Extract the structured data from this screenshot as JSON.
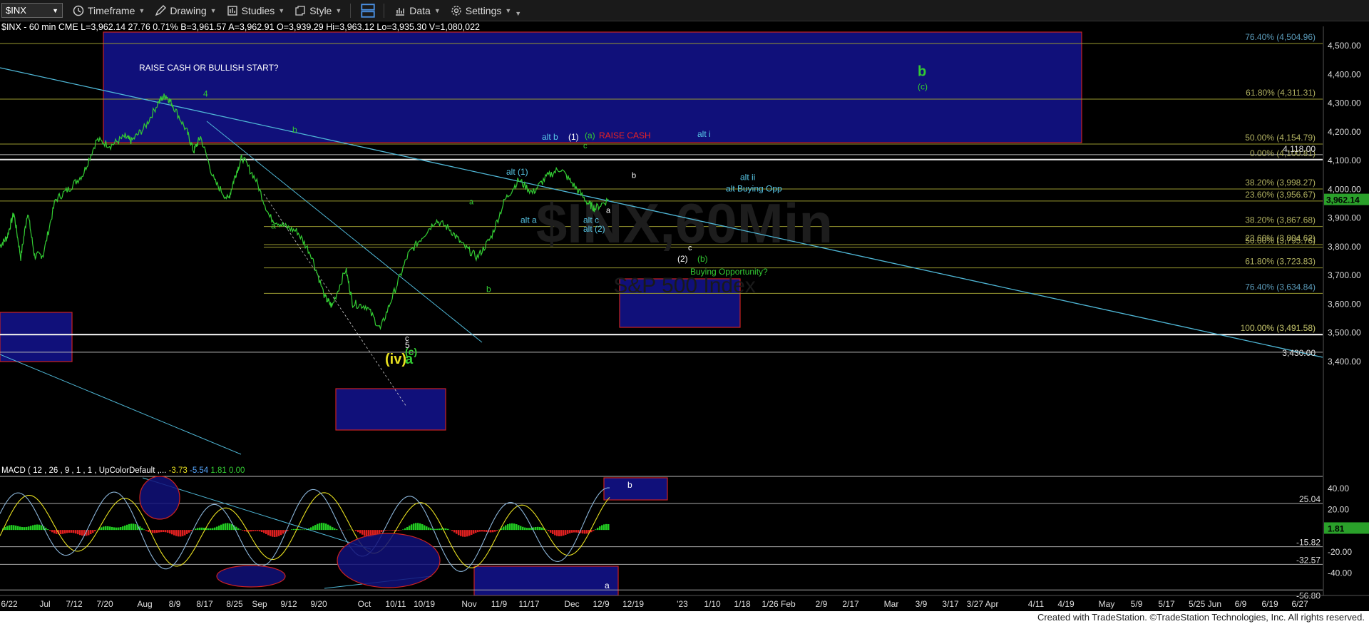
{
  "toolbar": {
    "symbol": "$INX",
    "timeframe": "Timeframe",
    "drawing": "Drawing",
    "studies": "Studies",
    "style": "Style",
    "data": "Data",
    "settings": "Settings"
  },
  "quote_line": "$INX - 60 min CME  L=3,962.14  27.76  0.71%  B=3,961.57  A=3,962.91  O=3,939.29  Hi=3,963.12  Lo=3,935.30  V=1,080,022",
  "watermark": "$INX,60Min",
  "watermark2": "S&P 500 Index",
  "macd_header": {
    "label": "MACD ( 12 , 26 , 9 , 1 , 1 , UpColorDefault ,...",
    "v1": "-3.73",
    "v2": "-5.54",
    "v3": "1.81",
    "v4": "0.00"
  },
  "footer": "Created with TradeStation. ©TradeStation Technologies, Inc. All rights reserved.",
  "colors": {
    "price": "#33cc33",
    "fib": "#9a9a30",
    "trend": "#4fb7d6",
    "box": "#10107a",
    "box_border": "#cc2222",
    "green_label": "#33cc33",
    "white_label": "#ffffff",
    "cyan_label": "#58c8e8",
    "yellow_label": "#e8e020",
    "red_label": "#ee2222"
  },
  "chart_data": {
    "type": "line",
    "title": "$INX - 60 min",
    "price_axis": {
      "ticks": [
        "4,500.00",
        "4,400.00",
        "4,300.00",
        "4,200.00",
        "4,100.00",
        "4,000.00",
        "3,900.00",
        "3,800.00",
        "3,700.00",
        "3,600.00",
        "3,500.00",
        "3,400.00"
      ],
      "ylim": [
        3350,
        4590
      ],
      "last_price": "3,962.14"
    },
    "x_axis": {
      "ticks": [
        "6/22",
        "Jul",
        "7/12",
        "7/20",
        "Aug",
        "8/9",
        "8/17",
        "8/25",
        "Sep",
        "9/12",
        "9/20",
        "Oct",
        "10/11",
        "10/19",
        "Nov",
        "11/9",
        "11/17",
        "Dec",
        "12/9",
        "12/19",
        "'23",
        "1/10",
        "1/18",
        "1/26 Feb",
        "2/9",
        "2/17",
        "Mar",
        "3/9",
        "3/17",
        "3/27 Apr",
        "4/11",
        "4/19",
        "May",
        "5/9",
        "5/17",
        "5/25 Jun",
        "6/9",
        "6/19",
        "6/27"
      ]
    },
    "price_series": {
      "name": "$INX",
      "points": [
        [
          0,
          3800
        ],
        [
          0.02,
          3830
        ],
        [
          0.04,
          3915
        ],
        [
          0.06,
          3760
        ],
        [
          0.08,
          3920
        ],
        [
          0.1,
          3765
        ],
        [
          0.125,
          3770
        ],
        [
          0.16,
          3960
        ],
        [
          0.2,
          4000
        ],
        [
          0.24,
          4050
        ],
        [
          0.28,
          4170
        ],
        [
          0.32,
          4150
        ],
        [
          0.36,
          4180
        ],
        [
          0.38,
          4165
        ],
        [
          0.42,
          4215
        ],
        [
          0.46,
          4305
        ],
        [
          0.48,
          4325
        ],
        [
          0.5,
          4290
        ],
        [
          0.54,
          4200
        ],
        [
          0.56,
          4130
        ],
        [
          0.58,
          4180
        ],
        [
          0.62,
          4025
        ],
        [
          0.66,
          3960
        ],
        [
          0.68,
          4045
        ],
        [
          0.7,
          4110
        ],
        [
          0.74,
          4030
        ],
        [
          0.78,
          3900
        ],
        [
          0.82,
          3870
        ],
        [
          0.86,
          3850
        ],
        [
          0.9,
          3770
        ],
        [
          0.94,
          3620
        ],
        [
          0.96,
          3590
        ],
        [
          1.0,
          3720
        ],
        [
          1.02,
          3600
        ],
        [
          1.06,
          3590
        ],
        [
          1.1,
          3510
        ],
        [
          1.14,
          3640
        ],
        [
          1.18,
          3770
        ],
        [
          1.22,
          3830
        ],
        [
          1.26,
          3890
        ],
        [
          1.3,
          3860
        ],
        [
          1.34,
          3800
        ],
        [
          1.38,
          3760
        ],
        [
          1.42,
          3830
        ],
        [
          1.46,
          3960
        ],
        [
          1.5,
          4030
        ],
        [
          1.54,
          3985
        ],
        [
          1.58,
          4040
        ],
        [
          1.62,
          4070
        ],
        [
          1.66,
          4010
        ],
        [
          1.7,
          3950
        ],
        [
          1.72,
          3930
        ],
        [
          1.76,
          3962
        ]
      ]
    },
    "fib_levels": [
      {
        "label": "76.40% (4,504.96)",
        "value": 4504.96
      },
      {
        "label": "61.80% (4,311.31)",
        "value": 4311.31
      },
      {
        "label": "50.00% (4,154.79)",
        "value": 4154.79
      },
      {
        "label": "0.00% (4,100.81)",
        "value": 4100.81
      },
      {
        "label": "38.20% (3,998.27)",
        "value": 3998.27
      },
      {
        "label": "23.60% (3,956.67)",
        "value": 3956.67
      },
      {
        "label": "38.20% (3,867.68)",
        "value": 3867.68
      },
      {
        "label": "23.60% (3,804.62)",
        "value": 3804.62
      },
      {
        "label": "50.00% (3,795.76)",
        "value": 3795.76
      },
      {
        "label": "61.80% (3,723.83)",
        "value": 3723.83
      },
      {
        "label": "76.40% (3,634.84)",
        "value": 3634.84
      },
      {
        "label": "100.00% (3,491.58)",
        "value": 3491.58
      },
      {
        "label": "0.00% (3,491.58)",
        "value": 3491.58
      }
    ],
    "horizontal_labels": [
      {
        "label": "4,118.00",
        "value": 4118
      },
      {
        "label": "3,430.00",
        "value": 3430
      }
    ],
    "annotations": [
      {
        "text": "RAISE CASH OR BULLISH START?",
        "color": "white",
        "value": 4411
      },
      {
        "text": "4",
        "color": "green",
        "value": 4320
      },
      {
        "text": "b",
        "color": "green",
        "value": 4195
      },
      {
        "text": "a",
        "color": "green",
        "value": 3860
      },
      {
        "text": "b",
        "color": "green",
        "value": 4392
      },
      {
        "text": "(c)",
        "color": "green",
        "value": 4345
      },
      {
        "text": "alt b",
        "color": "cyan",
        "value": 4170
      },
      {
        "text": "(1)",
        "color": "white",
        "value": 4170
      },
      {
        "text": "(a)",
        "color": "green",
        "value": 4175
      },
      {
        "text": "RAISE CASH",
        "color": "red",
        "value": 4175
      },
      {
        "text": "alt i",
        "color": "cyan",
        "value": 4180
      },
      {
        "text": "c",
        "color": "green",
        "value": 4140
      },
      {
        "text": "alt (1)",
        "color": "cyan",
        "value": 4048
      },
      {
        "text": "b",
        "color": "white",
        "value": 4037
      },
      {
        "text": "alt ii",
        "color": "cyan",
        "value": 4030
      },
      {
        "text": "alt Buying Opp",
        "color": "cyan",
        "value": 3990
      },
      {
        "text": "a",
        "color": "green",
        "value": 3945
      },
      {
        "text": "alt a",
        "color": "cyan",
        "value": 3880
      },
      {
        "text": "a",
        "color": "white",
        "value": 3915
      },
      {
        "text": "alt c",
        "color": "cyan",
        "value": 3880
      },
      {
        "text": "alt (2)",
        "color": "cyan",
        "value": 3850
      },
      {
        "text": "c",
        "color": "white",
        "value": 3785
      },
      {
        "text": "(2)",
        "color": "white",
        "value": 3745
      },
      {
        "text": "(b)",
        "color": "green",
        "value": 3745
      },
      {
        "text": "Buying Opportunity?",
        "color": "green",
        "value": 3700
      },
      {
        "text": "b",
        "color": "green",
        "value": 3640
      },
      {
        "text": "c",
        "color": "white",
        "value": 3470
      },
      {
        "text": "5",
        "color": "white",
        "value": 3445
      },
      {
        "text": "(c)",
        "color": "green",
        "value": 3420
      },
      {
        "text": "(iv)",
        "color": "yellow",
        "value": 3390
      },
      {
        "text": "a",
        "color": "green",
        "value": 3390
      }
    ],
    "macd": {
      "axis_ticks": [
        "40.00",
        "20.00",
        "-20.00",
        "-40.00"
      ],
      "levels": [
        {
          "label": "25.04",
          "value": 25.04
        },
        {
          "label": "-15.82",
          "value": -15.82
        },
        {
          "label": "-32.57",
          "value": -32.57
        },
        {
          "label": "-56.80",
          "value": -56.8
        }
      ],
      "last": "1.81",
      "box_labels": [
        "b",
        "a"
      ]
    }
  }
}
